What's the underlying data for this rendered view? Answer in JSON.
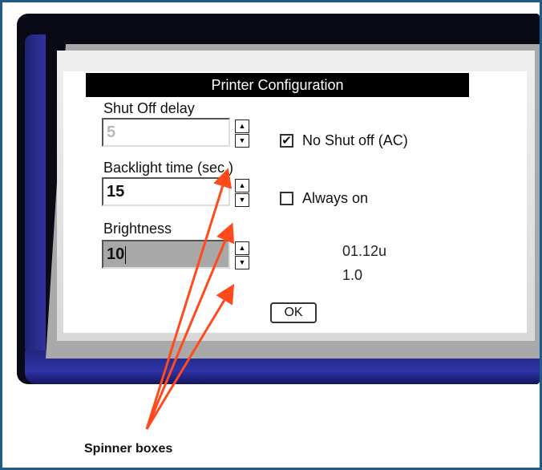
{
  "dialog": {
    "title": "Printer Configuration",
    "shutoff": {
      "label": "Shut Off delay",
      "value": "5"
    },
    "backlight": {
      "label": "Backlight time (sec.)",
      "value": "15"
    },
    "brightness": {
      "label": "Brightness",
      "value": "10"
    },
    "no_shutoff": {
      "label": "No Shut off (AC)",
      "checked": true,
      "mark": "✔"
    },
    "always_on": {
      "label": "Always on",
      "checked": false
    },
    "version_1": "01.12u",
    "version_2": "1.0",
    "ok_label": "OK"
  },
  "annotation": {
    "caption": "Spinner boxes",
    "arrow_color": "#ff4a1c"
  },
  "icons": {
    "spin_up": "▲",
    "spin_down": "▼"
  }
}
